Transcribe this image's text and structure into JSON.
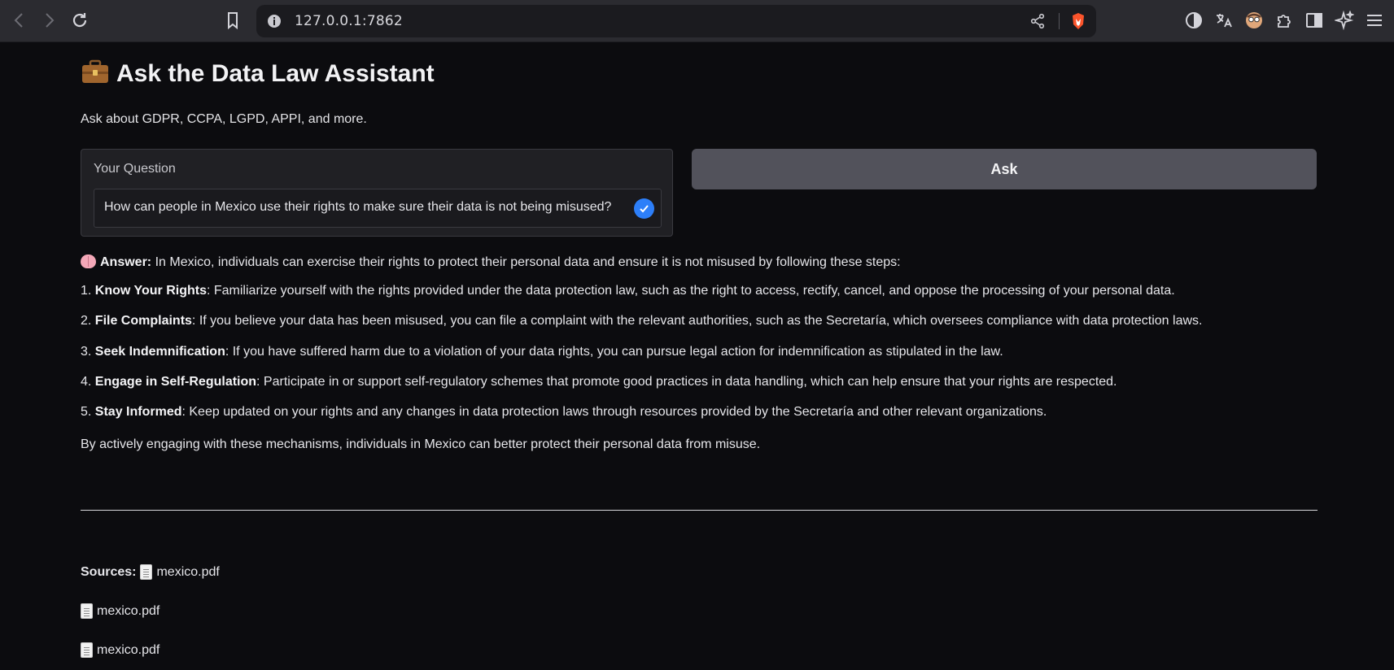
{
  "browser": {
    "url": "127.0.0.1:7862",
    "icons": [
      "back-icon",
      "forward-icon",
      "reload-icon",
      "bookmark-icon",
      "info-icon",
      "share-icon",
      "brave-shield-icon",
      "extension-dark-reader-icon",
      "translate-icon",
      "avatar-extension-icon",
      "puzzle-icon",
      "sidebar-icon",
      "leo-ai-icon",
      "menu-icon"
    ]
  },
  "page": {
    "title": "Ask the Data Law Assistant",
    "title_icon": "briefcase-icon",
    "subtitle": "Ask about GDPR, CCPA, LGPD, APPI, and more."
  },
  "question": {
    "label": "Your Question",
    "value": "How can people in Mexico use their rights to make sure their data is not being misused?"
  },
  "ask_button": {
    "label": "Ask"
  },
  "answer": {
    "icon": "brain-icon",
    "prefix": "Answer:",
    "intro": " In Mexico, individuals can exercise their rights to protect their personal data and ensure it is not misused by following these steps:",
    "steps": [
      {
        "num": "1. ",
        "title": "Know Your Rights",
        "text": ": Familiarize yourself with the rights provided under the data protection law, such as the right to access, rectify, cancel, and oppose the processing of your personal data."
      },
      {
        "num": "2. ",
        "title": "File Complaints",
        "text": ": If you believe your data has been misused, you can file a complaint with the relevant authorities, such as the Secretaría, which oversees compliance with data protection laws."
      },
      {
        "num": "3. ",
        "title": "Seek Indemnification",
        "text": ": If you have suffered harm due to a violation of your data rights, you can pursue legal action for indemnification as stipulated in the law."
      },
      {
        "num": "4. ",
        "title": "Engage in Self-Regulation",
        "text": ": Participate in or support self-regulatory schemes that promote good practices in data handling, which can help ensure that your rights are respected."
      },
      {
        "num": "5. ",
        "title": "Stay Informed",
        "text": ": Keep updated on your rights and any changes in data protection laws through resources provided by the Secretaría and other relevant organizations."
      }
    ],
    "closing": "By actively engaging with these mechanisms, individuals in Mexico can better protect their personal data from misuse."
  },
  "sources": {
    "label": "Sources:",
    "files": [
      "mexico.pdf",
      "mexico.pdf",
      "mexico.pdf"
    ]
  }
}
